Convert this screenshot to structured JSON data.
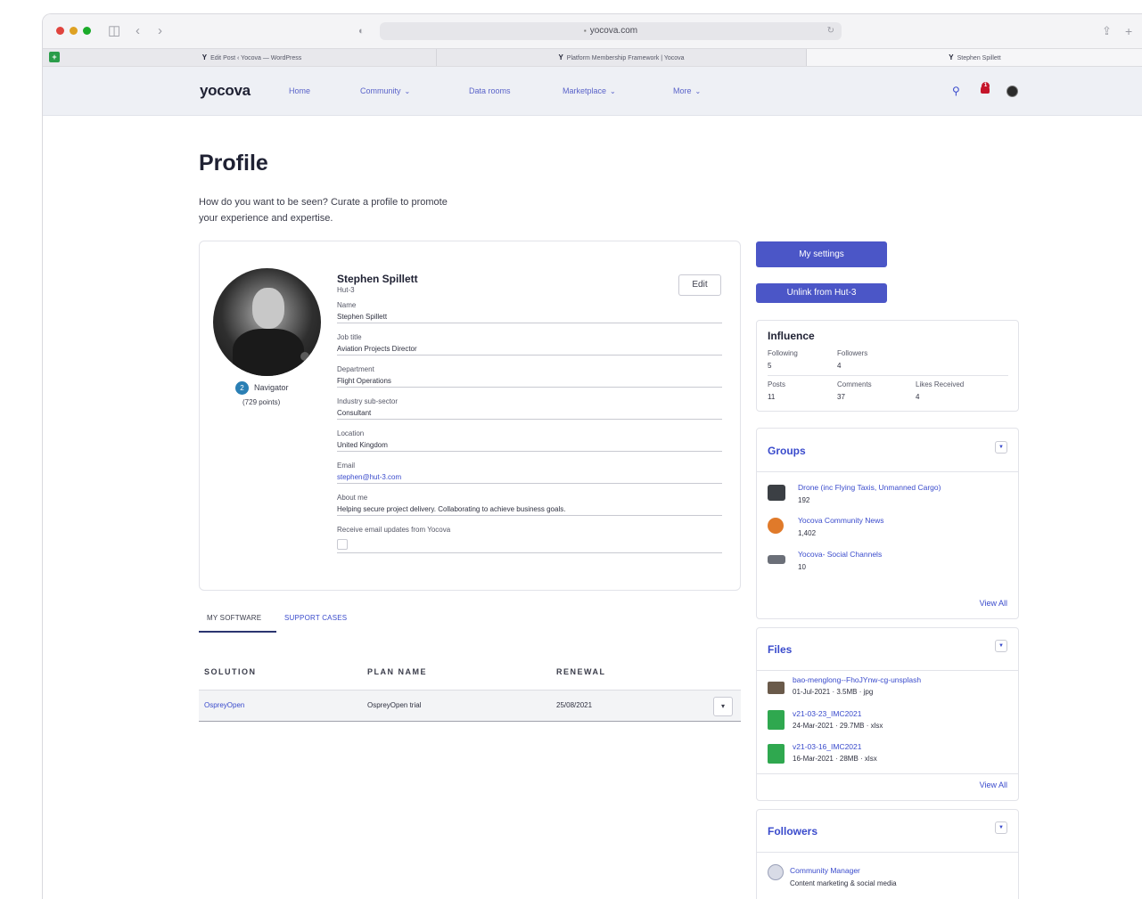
{
  "browser": {
    "address": "yocova.com",
    "tabs": [
      {
        "favicon": "Y",
        "title": "Edit Post ‹ Yocova — WordPress"
      },
      {
        "favicon": "Y",
        "title": "Platform Membership Framework | Yocova"
      },
      {
        "favicon": "Y",
        "title": "Stephen Spillett"
      }
    ]
  },
  "nav": {
    "logo": "yocova",
    "links": [
      "Home",
      "Community",
      "Data rooms",
      "Marketplace",
      "More"
    ],
    "notification_count": "1"
  },
  "page": {
    "title": "Profile",
    "subtitle": "How do you want to be seen? Curate a profile to promote your experience and expertise."
  },
  "profile": {
    "name": "Stephen Spillett",
    "company": "Hut-3",
    "edit_label": "Edit",
    "rank_number": "2",
    "rank_name": "Navigator",
    "points": "(729 points)",
    "fields": [
      {
        "label": "Name",
        "value": "Stephen Spillett"
      },
      {
        "label": "Job title",
        "value": "Aviation Projects Director"
      },
      {
        "label": "Department",
        "value": "Flight Operations"
      },
      {
        "label": "Industry sub-sector",
        "value": "Consultant"
      },
      {
        "label": "Location",
        "value": "United Kingdom"
      },
      {
        "label": "Email",
        "value": "stephen@hut-3.com"
      },
      {
        "label": "About me",
        "value": "Helping secure project delivery. Collaborating to achieve business goals."
      },
      {
        "label": "Receive email updates from Yocova",
        "value": ""
      }
    ]
  },
  "software": {
    "tabs": [
      "MY SOFTWARE",
      "SUPPORT CASES"
    ],
    "headers": [
      "SOLUTION",
      "PLAN NAME",
      "RENEWAL"
    ],
    "rows": [
      {
        "solution": "OspreyOpen",
        "plan": "OspreyOpen trial",
        "renewal": "25/08/2021"
      }
    ]
  },
  "sidebar": {
    "settings_label": "My settings",
    "unlink_label": "Unlink from Hut-3",
    "influence": {
      "title": "Influence",
      "stats": [
        {
          "label": "Following",
          "value": "5"
        },
        {
          "label": "Followers",
          "value": "4"
        },
        {
          "label": "Posts",
          "value": "11"
        },
        {
          "label": "Comments",
          "value": "37"
        },
        {
          "label": "Likes Received",
          "value": "4"
        }
      ]
    },
    "groups": {
      "title": "Groups",
      "items": [
        {
          "name": "Drone (inc Flying Taxis, Unmanned Cargo)",
          "count": "192"
        },
        {
          "name": "Yocova Community News",
          "count": "1,402"
        },
        {
          "name": "Yocova- Social Channels",
          "count": "10"
        }
      ],
      "view_all": "View All"
    },
    "files": {
      "title": "Files",
      "items": [
        {
          "name": "bao-menglong--FhoJYnw-cg-unsplash",
          "meta": "01-Jul-2021 · 3.5MB · jpg"
        },
        {
          "name": "v21-03-23_IMC2021",
          "meta": "24-Mar-2021 · 29.7MB · xlsx"
        },
        {
          "name": "v21-03-16_IMC2021",
          "meta": "16-Mar-2021 · 28MB · xlsx"
        }
      ],
      "view_all": "View All"
    },
    "followers": {
      "title": "Followers",
      "items": [
        {
          "name": "Community Manager",
          "desc": "Content marketing & social media"
        }
      ]
    }
  },
  "colors": {
    "primary": "#4b56c7",
    "link": "#3a4bcc",
    "navbar_bg": "#eef0f5",
    "alert": "#c4152a"
  }
}
